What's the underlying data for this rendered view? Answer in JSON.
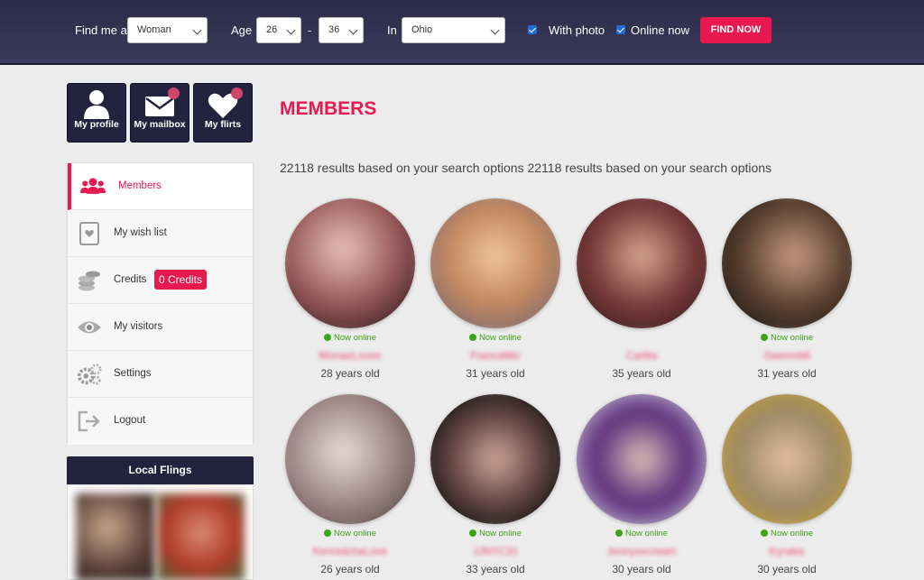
{
  "search": {
    "find_label": "Find me a",
    "gender": "Woman",
    "age_label": "Age",
    "age_min": "26",
    "age_sep": "-",
    "age_max": "36",
    "in_label": "In",
    "location": "Ohio",
    "with_photo": "With photo",
    "online_now": "Online now",
    "button": "FIND NOW"
  },
  "tiles": [
    {
      "label": "My profile",
      "icon": "user-icon"
    },
    {
      "label": "My mailbox",
      "icon": "envelope-icon"
    },
    {
      "label": "My flirts",
      "icon": "heart-icon"
    }
  ],
  "menu": [
    {
      "label": "Members",
      "icon": "users-icon",
      "active": true
    },
    {
      "label": "My wish list",
      "icon": "wishlist-icon"
    },
    {
      "label": "Credits",
      "icon": "coins-icon",
      "badge": "0 Credits"
    },
    {
      "label": "My visitors",
      "icon": "eye-icon"
    },
    {
      "label": "Settings",
      "icon": "gears-icon"
    },
    {
      "label": "Logout",
      "icon": "logout-icon"
    }
  ],
  "local_flings": {
    "title": "Local Flings"
  },
  "main": {
    "title": "MEMBERS",
    "results": "22118 results based on your search options 22118 results based on your search options"
  },
  "members": [
    {
      "status": "Now online",
      "name": "MonaeLovee",
      "age": "28 years old"
    },
    {
      "status": "Now online",
      "name": "FrancaMic",
      "age": "31 years old"
    },
    {
      "status": "",
      "name": "Carlita",
      "age": "35 years old"
    },
    {
      "status": "Now online",
      "name": "Gwenniiill",
      "age": "31 years old"
    },
    {
      "status": "Now online",
      "name": "KennidchaLove",
      "age": "26 years old"
    },
    {
      "status": "Now online",
      "name": "JJNYC31",
      "age": "33 years old"
    },
    {
      "status": "Now online",
      "name": "Jennyxxcream",
      "age": "30 years old"
    },
    {
      "status": "Now online",
      "name": "Kyrakis",
      "age": "30 years old"
    }
  ],
  "colors": {
    "accent": "#e8194f",
    "dark": "#232340",
    "online": "#3ca418"
  }
}
